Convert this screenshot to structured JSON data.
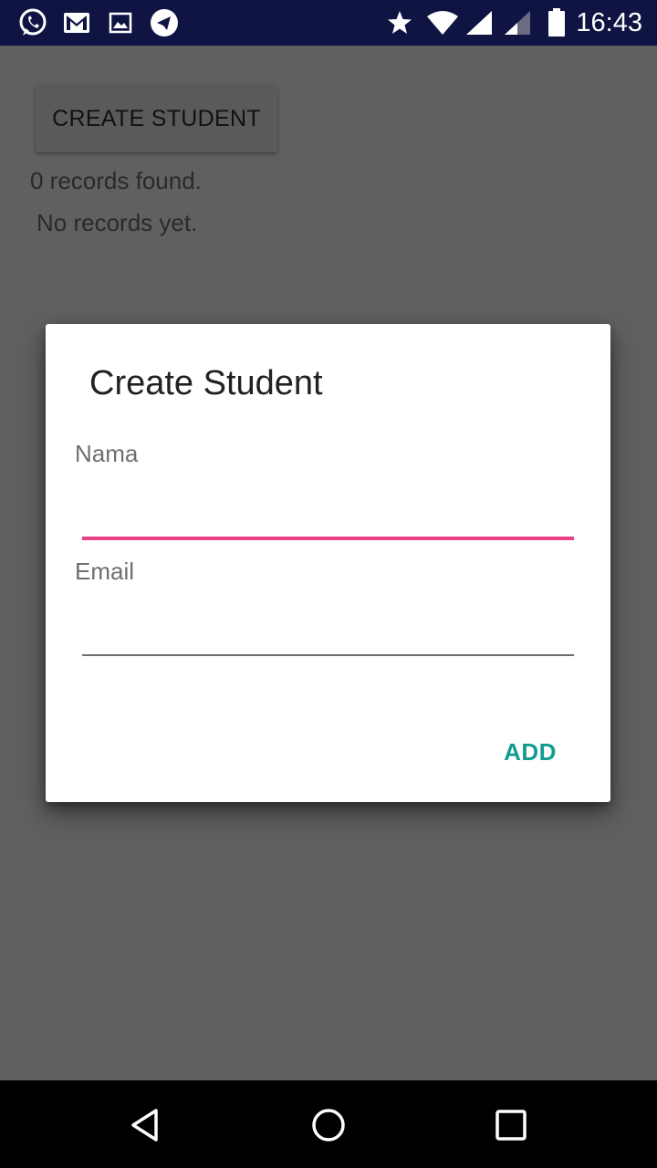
{
  "status_bar": {
    "time": "16:43",
    "left_icons": [
      "whatsapp-icon",
      "gmail-icon",
      "gallery-icon",
      "telegram-icon"
    ],
    "right_icons": [
      "star-icon",
      "wifi-icon",
      "signal-icon",
      "signal-icon",
      "battery-icon"
    ],
    "background": "#101443"
  },
  "main": {
    "create_button_label": "CREATE STUDENT",
    "records_count": "0 records found.",
    "empty_message": "No records yet."
  },
  "dialog": {
    "title": "Create Student",
    "name_label": "Nama",
    "name_value": "",
    "email_label": "Email",
    "email_value": "",
    "add_button_label": "ADD",
    "accent_color": "#129c8e",
    "focus_color": "#e94386"
  },
  "nav_bar": {
    "buttons": [
      "back-icon",
      "home-icon",
      "recents-icon"
    ]
  }
}
